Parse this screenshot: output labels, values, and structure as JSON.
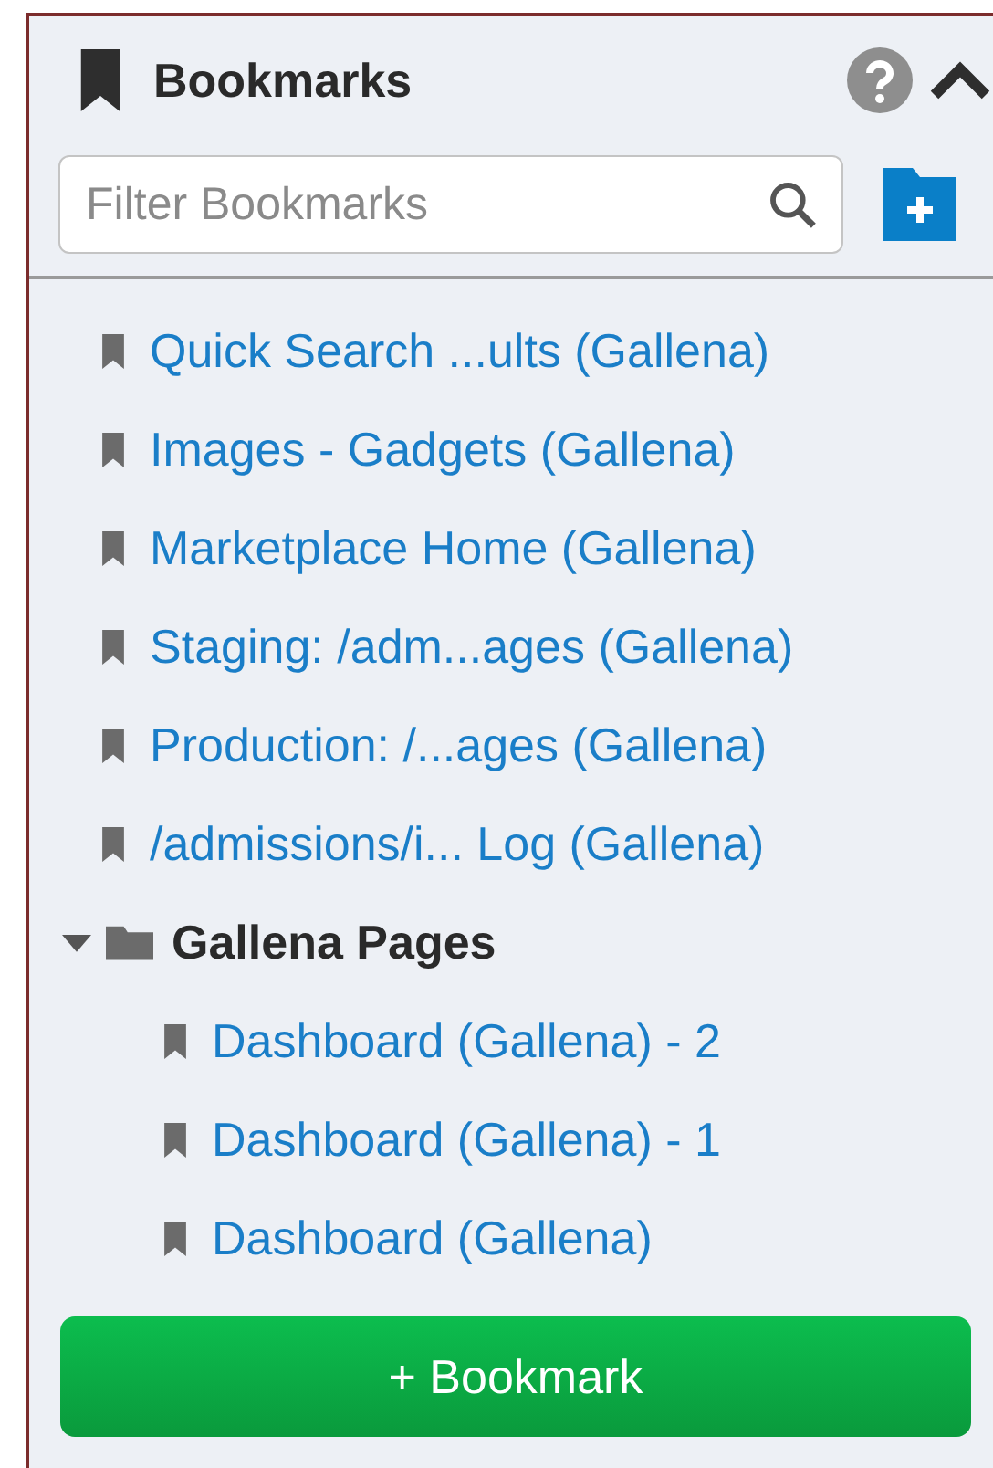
{
  "panel": {
    "title": "Bookmarks",
    "filter": {
      "placeholder": "Filter Bookmarks"
    },
    "bookmarks": [
      {
        "kind": "bookmark",
        "label": "Quick Search ...ults (Gallena)"
      },
      {
        "kind": "bookmark",
        "label": "Images - Gadgets (Gallena)"
      },
      {
        "kind": "bookmark",
        "label": "Marketplace Home (Gallena)"
      },
      {
        "kind": "bookmark",
        "label": "Staging: /adm...ages (Gallena)"
      },
      {
        "kind": "bookmark",
        "label": "Production: /...ages (Gallena)"
      },
      {
        "kind": "bookmark",
        "label": "/admissions/i... Log (Gallena)"
      },
      {
        "kind": "folder",
        "label": "Gallena Pages",
        "expanded": true,
        "children": [
          {
            "kind": "bookmark",
            "label": "Dashboard (Gallena) - 2"
          },
          {
            "kind": "bookmark",
            "label": "Dashboard (Gallena) - 1"
          },
          {
            "kind": "bookmark",
            "label": "Dashboard (Gallena)"
          }
        ]
      }
    ],
    "add_button": "+ Bookmark"
  }
}
